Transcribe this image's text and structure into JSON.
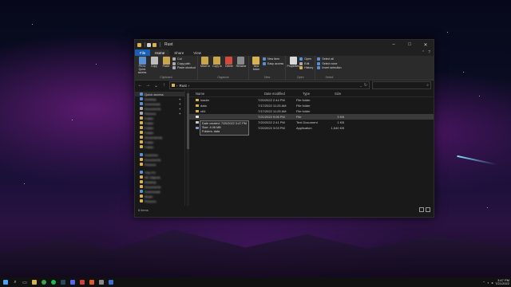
{
  "window": {
    "title": "Rust",
    "min": "–",
    "max": "□",
    "close": "✕"
  },
  "ribbon_tabs": [
    "File",
    "Home",
    "Share",
    "View"
  ],
  "ribbon": {
    "clipboard": {
      "label": "Clipboard",
      "pin": "Pin to Quick access",
      "copy": "Copy",
      "paste": "Paste",
      "cut": "Cut",
      "copy_path": "Copy path",
      "paste_shortcut": "Paste shortcut"
    },
    "organize": {
      "label": "Organize",
      "move_to": "Move to",
      "copy_to": "Copy to",
      "delete": "Delete",
      "rename": "Rename"
    },
    "new": {
      "label": "New",
      "new_folder": "New folder",
      "new_item": "New item",
      "easy_access": "Easy access"
    },
    "open": {
      "label": "Open",
      "properties": "Properties",
      "open": "Open",
      "edit": "Edit",
      "history": "History"
    },
    "select": {
      "label": "Select",
      "select_all": "Select all",
      "select_none": "Select none",
      "invert": "Invert selection"
    }
  },
  "address": {
    "crumb": "Rust",
    "sep": "›"
  },
  "nav": {
    "quick_access": "Quick access"
  },
  "columns": {
    "name": "Name",
    "date": "Date modified",
    "type": "Type",
    "size": "Size"
  },
  "files": [
    {
      "name": "loader",
      "date": "7/20/2022 2:44 PM",
      "type": "File folder",
      "size": "",
      "kind": "folder"
    },
    {
      "name": "data",
      "date": "7/17/2022 11:25 AM",
      "type": "File folder",
      "size": "",
      "kind": "folder"
    },
    {
      "name": "x64",
      "date": "7/17/2022 11:25 AM",
      "type": "File folder",
      "size": "",
      "kind": "folder"
    },
    {
      "name": "",
      "date": "7/21/2022 9:06 PM",
      "type": "File",
      "size": "3 KB",
      "kind": "file"
    },
    {
      "name": "",
      "date": "7/20/2022 2:41 PM",
      "type": "Text Document",
      "size": "1 KB",
      "kind": "text"
    },
    {
      "name": "",
      "date": "7/20/2022 3:03 PM",
      "type": "Application",
      "size": "1,640 KB",
      "kind": "app"
    }
  ],
  "tooltip": {
    "line1": "Date created: 7/20/2022 3:47 PM",
    "line2": "Size: 4.08 MB",
    "line3": "Folders: data"
  },
  "status": {
    "items": "6 items"
  },
  "taskbar": {
    "time": "3:47 PM",
    "date": "7/21/2022"
  },
  "colors": {
    "accent": "#1a5fb4",
    "folder": "#d9b250"
  }
}
